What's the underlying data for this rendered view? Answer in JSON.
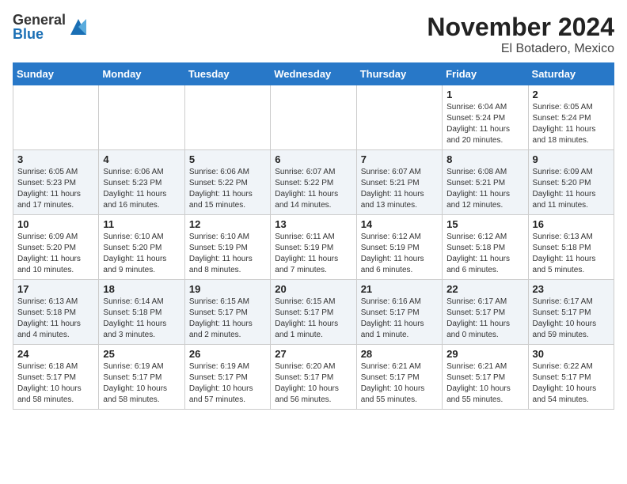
{
  "logo": {
    "general": "General",
    "blue": "Blue"
  },
  "title": "November 2024",
  "subtitle": "El Botadero, Mexico",
  "headers": [
    "Sunday",
    "Monday",
    "Tuesday",
    "Wednesday",
    "Thursday",
    "Friday",
    "Saturday"
  ],
  "weeks": [
    [
      {
        "day": "",
        "info": ""
      },
      {
        "day": "",
        "info": ""
      },
      {
        "day": "",
        "info": ""
      },
      {
        "day": "",
        "info": ""
      },
      {
        "day": "",
        "info": ""
      },
      {
        "day": "1",
        "info": "Sunrise: 6:04 AM\nSunset: 5:24 PM\nDaylight: 11 hours and 20 minutes."
      },
      {
        "day": "2",
        "info": "Sunrise: 6:05 AM\nSunset: 5:24 PM\nDaylight: 11 hours and 18 minutes."
      }
    ],
    [
      {
        "day": "3",
        "info": "Sunrise: 6:05 AM\nSunset: 5:23 PM\nDaylight: 11 hours and 17 minutes."
      },
      {
        "day": "4",
        "info": "Sunrise: 6:06 AM\nSunset: 5:23 PM\nDaylight: 11 hours and 16 minutes."
      },
      {
        "day": "5",
        "info": "Sunrise: 6:06 AM\nSunset: 5:22 PM\nDaylight: 11 hours and 15 minutes."
      },
      {
        "day": "6",
        "info": "Sunrise: 6:07 AM\nSunset: 5:22 PM\nDaylight: 11 hours and 14 minutes."
      },
      {
        "day": "7",
        "info": "Sunrise: 6:07 AM\nSunset: 5:21 PM\nDaylight: 11 hours and 13 minutes."
      },
      {
        "day": "8",
        "info": "Sunrise: 6:08 AM\nSunset: 5:21 PM\nDaylight: 11 hours and 12 minutes."
      },
      {
        "day": "9",
        "info": "Sunrise: 6:09 AM\nSunset: 5:20 PM\nDaylight: 11 hours and 11 minutes."
      }
    ],
    [
      {
        "day": "10",
        "info": "Sunrise: 6:09 AM\nSunset: 5:20 PM\nDaylight: 11 hours and 10 minutes."
      },
      {
        "day": "11",
        "info": "Sunrise: 6:10 AM\nSunset: 5:20 PM\nDaylight: 11 hours and 9 minutes."
      },
      {
        "day": "12",
        "info": "Sunrise: 6:10 AM\nSunset: 5:19 PM\nDaylight: 11 hours and 8 minutes."
      },
      {
        "day": "13",
        "info": "Sunrise: 6:11 AM\nSunset: 5:19 PM\nDaylight: 11 hours and 7 minutes."
      },
      {
        "day": "14",
        "info": "Sunrise: 6:12 AM\nSunset: 5:19 PM\nDaylight: 11 hours and 6 minutes."
      },
      {
        "day": "15",
        "info": "Sunrise: 6:12 AM\nSunset: 5:18 PM\nDaylight: 11 hours and 6 minutes."
      },
      {
        "day": "16",
        "info": "Sunrise: 6:13 AM\nSunset: 5:18 PM\nDaylight: 11 hours and 5 minutes."
      }
    ],
    [
      {
        "day": "17",
        "info": "Sunrise: 6:13 AM\nSunset: 5:18 PM\nDaylight: 11 hours and 4 minutes."
      },
      {
        "day": "18",
        "info": "Sunrise: 6:14 AM\nSunset: 5:18 PM\nDaylight: 11 hours and 3 minutes."
      },
      {
        "day": "19",
        "info": "Sunrise: 6:15 AM\nSunset: 5:17 PM\nDaylight: 11 hours and 2 minutes."
      },
      {
        "day": "20",
        "info": "Sunrise: 6:15 AM\nSunset: 5:17 PM\nDaylight: 11 hours and 1 minute."
      },
      {
        "day": "21",
        "info": "Sunrise: 6:16 AM\nSunset: 5:17 PM\nDaylight: 11 hours and 1 minute."
      },
      {
        "day": "22",
        "info": "Sunrise: 6:17 AM\nSunset: 5:17 PM\nDaylight: 11 hours and 0 minutes."
      },
      {
        "day": "23",
        "info": "Sunrise: 6:17 AM\nSunset: 5:17 PM\nDaylight: 10 hours and 59 minutes."
      }
    ],
    [
      {
        "day": "24",
        "info": "Sunrise: 6:18 AM\nSunset: 5:17 PM\nDaylight: 10 hours and 58 minutes."
      },
      {
        "day": "25",
        "info": "Sunrise: 6:19 AM\nSunset: 5:17 PM\nDaylight: 10 hours and 58 minutes."
      },
      {
        "day": "26",
        "info": "Sunrise: 6:19 AM\nSunset: 5:17 PM\nDaylight: 10 hours and 57 minutes."
      },
      {
        "day": "27",
        "info": "Sunrise: 6:20 AM\nSunset: 5:17 PM\nDaylight: 10 hours and 56 minutes."
      },
      {
        "day": "28",
        "info": "Sunrise: 6:21 AM\nSunset: 5:17 PM\nDaylight: 10 hours and 55 minutes."
      },
      {
        "day": "29",
        "info": "Sunrise: 6:21 AM\nSunset: 5:17 PM\nDaylight: 10 hours and 55 minutes."
      },
      {
        "day": "30",
        "info": "Sunrise: 6:22 AM\nSunset: 5:17 PM\nDaylight: 10 hours and 54 minutes."
      }
    ]
  ]
}
